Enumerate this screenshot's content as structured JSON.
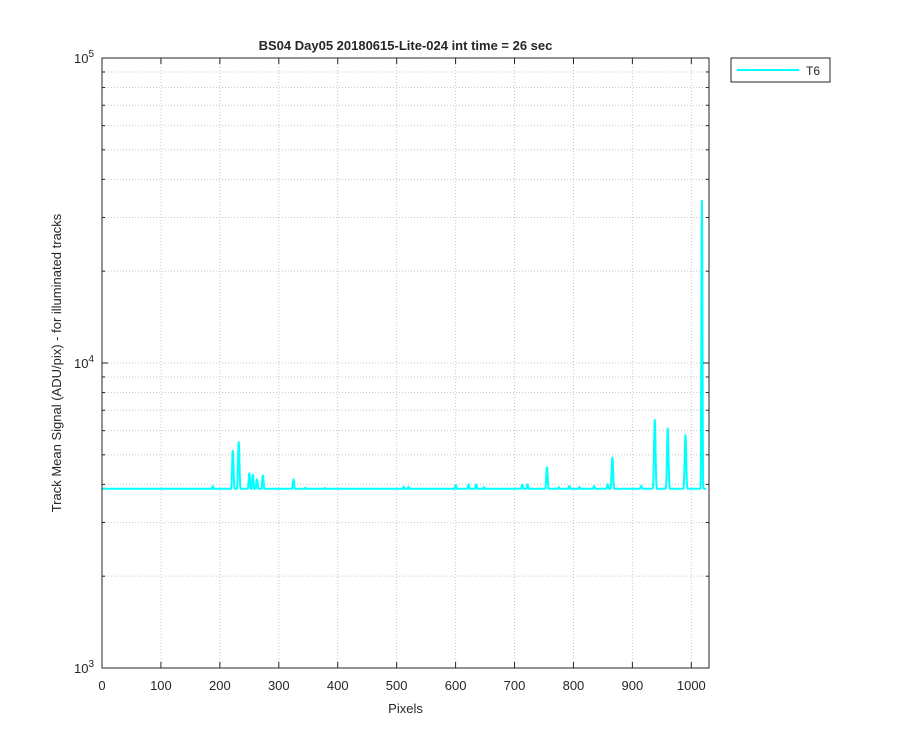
{
  "chart_data": {
    "type": "line",
    "title": "BS04 Day05 20180615-Lite-024 int time = 26 sec",
    "xlabel": "Pixels",
    "ylabel": "Track Mean Signal (ADU/pix) - for illuminated tracks",
    "xlim": [
      0,
      1030
    ],
    "ylim": [
      1000,
      100000
    ],
    "yscale": "log",
    "grid": "on",
    "legend_position": "top-right outside",
    "x_ticks": [
      "0",
      "100",
      "200",
      "300",
      "400",
      "500",
      "600",
      "700",
      "800",
      "900",
      "1000"
    ],
    "y_ticks": [
      {
        "base": "10",
        "exp": "3"
      },
      {
        "base": "10",
        "exp": "4"
      },
      {
        "base": "10",
        "exp": "5"
      }
    ],
    "series": [
      {
        "name": "T6",
        "color": "#00ffff",
        "baseline": [
          [
            0,
            3760
          ],
          [
            100,
            3780
          ],
          [
            200,
            3800
          ],
          [
            300,
            3820
          ],
          [
            400,
            3830
          ],
          [
            500,
            3830
          ],
          [
            600,
            3830
          ],
          [
            700,
            3830
          ],
          [
            800,
            3840
          ],
          [
            900,
            3850
          ],
          [
            1015,
            3870
          ],
          [
            1025,
            3870
          ]
        ],
        "peaks": [
          {
            "x": 160,
            "y": 3850
          },
          {
            "x": 188,
            "y": 3950
          },
          {
            "x": 222,
            "y": 5150
          },
          {
            "x": 232,
            "y": 5500
          },
          {
            "x": 250,
            "y": 4350
          },
          {
            "x": 256,
            "y": 4300
          },
          {
            "x": 263,
            "y": 4150
          },
          {
            "x": 273,
            "y": 4280
          },
          {
            "x": 325,
            "y": 4150
          },
          {
            "x": 345,
            "y": 3900
          },
          {
            "x": 378,
            "y": 3890
          },
          {
            "x": 512,
            "y": 3930
          },
          {
            "x": 520,
            "y": 3920
          },
          {
            "x": 600,
            "y": 3980
          },
          {
            "x": 622,
            "y": 4000
          },
          {
            "x": 635,
            "y": 4000
          },
          {
            "x": 648,
            "y": 3920
          },
          {
            "x": 713,
            "y": 3990
          },
          {
            "x": 722,
            "y": 4000
          },
          {
            "x": 755,
            "y": 4550
          },
          {
            "x": 775,
            "y": 3920
          },
          {
            "x": 793,
            "y": 3950
          },
          {
            "x": 810,
            "y": 3920
          },
          {
            "x": 835,
            "y": 3950
          },
          {
            "x": 858,
            "y": 4000
          },
          {
            "x": 866,
            "y": 4900
          },
          {
            "x": 915,
            "y": 3960
          },
          {
            "x": 938,
            "y": 6500
          },
          {
            "x": 960,
            "y": 6100
          },
          {
            "x": 990,
            "y": 5800
          },
          {
            "x": 1018,
            "y": 34000
          }
        ]
      }
    ]
  }
}
